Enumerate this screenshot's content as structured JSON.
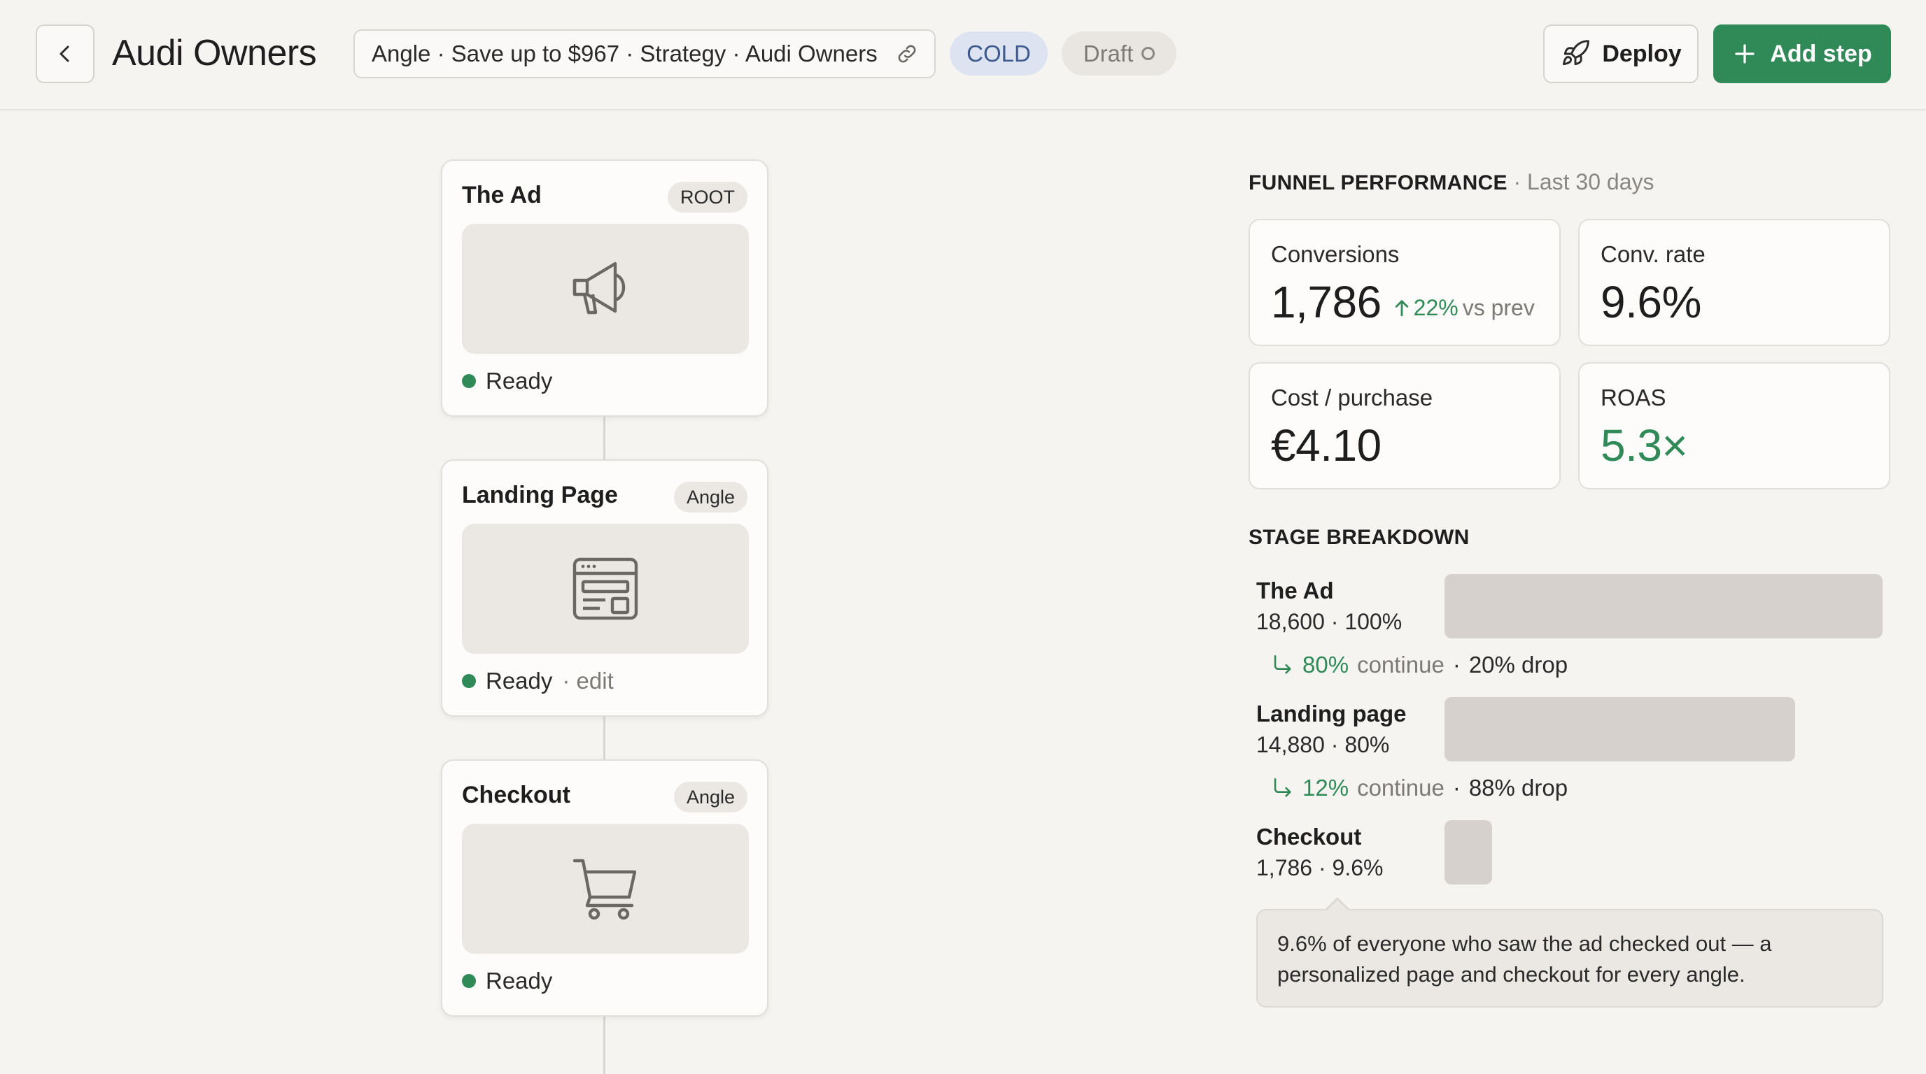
{
  "header": {
    "title": "Audi Owners",
    "breadcrumb": "Angle · Save up to $967 · Strategy · Audi Owners",
    "badge_cold": "COLD",
    "badge_draft": "Draft",
    "deploy_label": "Deploy",
    "add_step_label": "Add step"
  },
  "flow": {
    "steps": [
      {
        "title": "The Ad",
        "tag": "ROOT",
        "icon": "megaphone-icon",
        "status": "Ready",
        "edit": ""
      },
      {
        "title": "Landing Page",
        "tag": "Angle",
        "icon": "webpage-icon",
        "status": "Ready",
        "edit": "· edit"
      },
      {
        "title": "Checkout",
        "tag": "Angle",
        "icon": "cart-icon",
        "status": "Ready",
        "edit": ""
      }
    ]
  },
  "performance": {
    "heading": "FUNNEL PERFORMANCE",
    "period": "· Last 30 days",
    "metrics": [
      {
        "label": "Conversions",
        "value": "1,786",
        "delta": "22%",
        "delta_sub": "vs prev"
      },
      {
        "label": "Conv. rate",
        "value": "9.6%"
      },
      {
        "label": "Cost / purchase",
        "value": "€4.10"
      },
      {
        "label": "ROAS",
        "value": "5.3×"
      }
    ]
  },
  "breakdown": {
    "heading": "STAGE BREAKDOWN",
    "stages": [
      {
        "name": "The Ad",
        "stats": "18,600 · 100%",
        "share": 1.0
      },
      {
        "name": "Landing page",
        "stats": "14,880 · 80%",
        "share": 0.8
      },
      {
        "name": "Checkout",
        "stats": "1,786 · 9.6%",
        "share": 0.096
      }
    ],
    "transitions": [
      {
        "continue_pct": "80%",
        "continue_word": "continue",
        "sep": "·",
        "drop": "20% drop"
      },
      {
        "continue_pct": "12%",
        "continue_word": "continue",
        "sep": "·",
        "drop": "88% drop"
      }
    ],
    "note": "9.6% of everyone who saw the ad checked out — a personalized page and checkout for every angle."
  },
  "colors": {
    "accent_green": "#2f8a57",
    "cold_badge_bg": "#dde3f1",
    "cold_badge_text": "#3d5a8e",
    "bar_fill": "#d6d1cc"
  }
}
